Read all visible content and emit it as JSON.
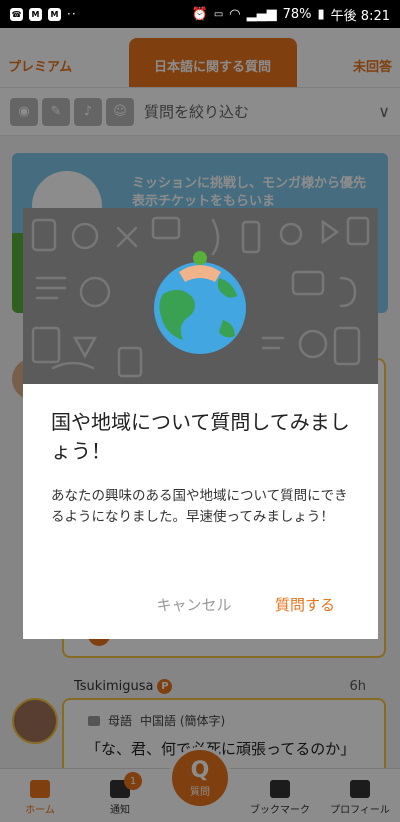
{
  "status_bar": {
    "battery": "78%",
    "time": "午後 8:21",
    "dots": "··"
  },
  "tabs": [
    {
      "label": "プレミアム"
    },
    {
      "label": "日本語に関する質問"
    },
    {
      "label": "未回答"
    }
  ],
  "filter": {
    "label": "質問を絞り込む"
  },
  "banner": {
    "text": "ミッションに挑戦し、モンガ様から優先表示チケットをもらいま"
  },
  "post": {
    "username": "Tsukimigusa",
    "badge": "P",
    "time": "6h",
    "language_prefix": "母語",
    "language": "中国語 (簡体字)",
    "body": "「な、君、何で必死に頑張ってるのか」"
  },
  "bottom_nav": {
    "home": "ホーム",
    "notifications": "通知",
    "notifications_count": "1",
    "ask": "質問",
    "ask_glyph": "Q",
    "bookmarks": "ブックマーク",
    "profile": "プロフィール"
  },
  "dialog": {
    "title": "国や地域について質問してみましょう！",
    "message": "あなたの興味のある国や地域について質問にできるようになりました。早速使ってみましょう！",
    "cancel_label": "キャンセル",
    "confirm_label": "質問する"
  },
  "colors": {
    "accent": "#e8731a",
    "highlight_border": "#f2c443",
    "globe_ocean": "#42a6e0",
    "globe_land": "#3aa052"
  }
}
